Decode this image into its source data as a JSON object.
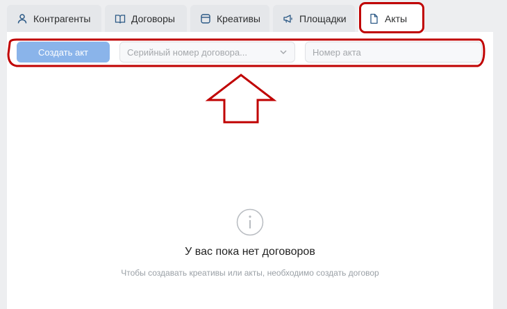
{
  "tabs": [
    {
      "label": "Контрагенты",
      "icon": "user-icon"
    },
    {
      "label": "Договоры",
      "icon": "book-icon"
    },
    {
      "label": "Креативы",
      "icon": "card-icon"
    },
    {
      "label": "Площадки",
      "icon": "megaphone-icon"
    },
    {
      "label": "Акты",
      "icon": "document-icon",
      "active": true
    }
  ],
  "toolbar": {
    "create_label": "Создать акт",
    "contract_select_placeholder": "Серийный номер договора...",
    "act_number_placeholder": "Номер акта"
  },
  "empty_state": {
    "icon": "info-icon",
    "title": "У вас пока нет договоров",
    "subtitle": "Чтобы создавать креативы или акты, необходимо создать договор"
  },
  "colors": {
    "accent": "#8ab4ea",
    "annotation": "#c00000",
    "icon": "#2a5885"
  }
}
